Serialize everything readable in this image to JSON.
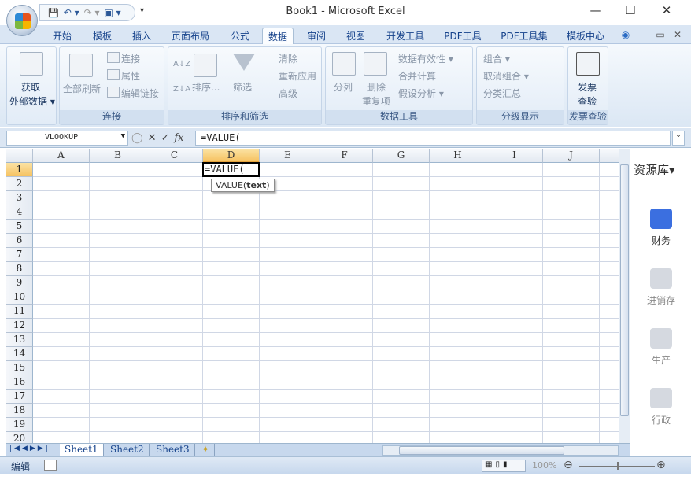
{
  "window": {
    "title": "Book1 - Microsoft Excel",
    "minimize": "—",
    "maximize": "☐",
    "close": "✕"
  },
  "qat": {
    "save": "💾",
    "undo": "↶ ▾",
    "redo": "↷ ▾",
    "extra": "▣ ▾",
    "customize": "▾"
  },
  "tabs": [
    "开始",
    "模板",
    "插入",
    "页面布局",
    "公式",
    "数据",
    "审阅",
    "视图",
    "开发工具",
    "PDF工具",
    "PDF工具集",
    "模板中心"
  ],
  "active_tab": "数据",
  "ribbon": {
    "get_external": {
      "line1": "获取",
      "line2": "外部数据 ▾"
    },
    "connections": {
      "label": "连接",
      "refresh_all": "全部刷新",
      "connect": "连接",
      "properties": "属性",
      "edit_links": "编辑链接"
    },
    "sort_filter": {
      "label": "排序和筛选",
      "sort": "排序...",
      "filter": "筛选",
      "clear": "清除",
      "reapply": "重新应用",
      "advanced": "高级",
      "az": "A↓Z",
      "za": "Z↓A"
    },
    "data_tools": {
      "label": "数据工具",
      "text_to_columns": "分列",
      "remove_dup_1": "删除",
      "remove_dup_2": "重复项",
      "validation": "数据有效性 ▾",
      "consolidate": "合并计算",
      "what_if": "假设分析 ▾"
    },
    "outline": {
      "label": "分级显示",
      "group": "组合 ▾",
      "ungroup": "取消组合 ▾",
      "subtotal": "分类汇总"
    },
    "invoice": {
      "label": "发票查验",
      "btn1": "发票",
      "btn2": "查验"
    }
  },
  "formula_bar": {
    "name_box": "VLOOKUP",
    "value": "=VALUE("
  },
  "grid": {
    "columns": [
      "A",
      "B",
      "C",
      "D",
      "E",
      "F",
      "G",
      "H",
      "I",
      "J"
    ],
    "rows": [
      "1",
      "2",
      "3",
      "4",
      "5",
      "6",
      "7",
      "8",
      "9",
      "10",
      "11",
      "12",
      "13",
      "14",
      "15",
      "16",
      "17",
      "18",
      "19",
      "20"
    ],
    "active_col": "D",
    "active_row": "1",
    "active_text": "=VALUE(",
    "tooltip_fn": "VALUE(",
    "tooltip_arg": "text",
    "tooltip_end": ")"
  },
  "sheets": [
    "Sheet1",
    "Sheet2",
    "Sheet3"
  ],
  "active_sheet": "Sheet1",
  "status": {
    "mode": "编辑",
    "zoom": "100%"
  },
  "side_panel": {
    "title": "资源库▾",
    "items": [
      "财务",
      "进销存",
      "生产",
      "行政"
    ]
  }
}
